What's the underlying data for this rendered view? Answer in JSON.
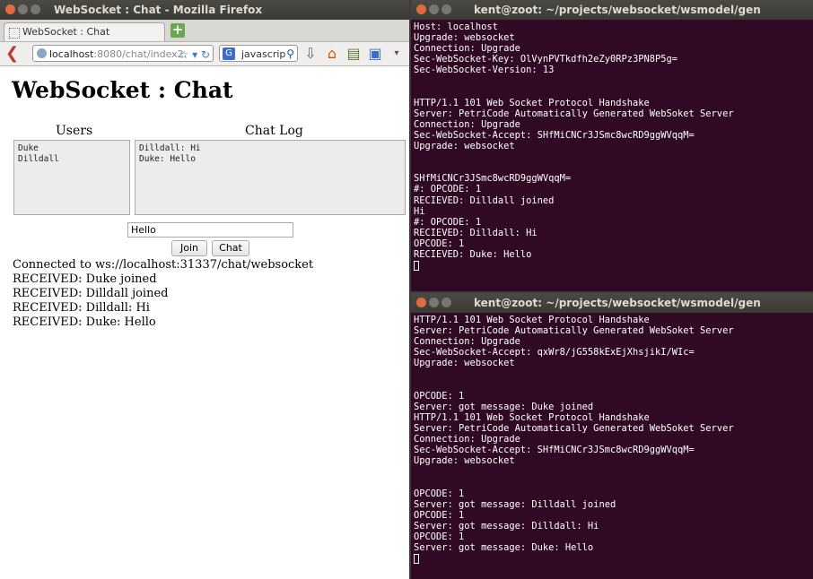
{
  "firefox": {
    "window_title": "WebSocket : Chat - Mozilla Firefox",
    "tab_title": "WebSocket : Chat",
    "url_host": "localhost",
    "url_rest": ":8080/chat/index2.",
    "search_text": "javascrip",
    "search_engine": "G"
  },
  "page": {
    "heading": "WebSocket : Chat",
    "users_label": "Users",
    "chatlog_label": "Chat Log",
    "users": "Duke\nDilldall",
    "chatlog": "Dilldall: Hi\nDuke: Hello",
    "message_value": "Hello",
    "join_label": "Join",
    "chat_label": "Chat",
    "log": [
      "Connected to ws://localhost:31337/chat/websocket",
      "RECEIVED: Duke joined",
      "RECEIVED: Dilldall joined",
      "RECEIVED: Dilldall: Hi",
      "RECEIVED: Duke: Hello"
    ]
  },
  "terminal_top": {
    "title": "kent@zoot: ~/projects/websocket/wsmodel/gen",
    "text": "Host: localhost\nUpgrade: websocket\nConnection: Upgrade\nSec-WebSocket-Key: OlVynPVTkdfh2eZy0RPz3PN8P5g=\nSec-WebSocket-Version: 13\n\n\nHTTP/1.1 101 Web Socket Protocol Handshake\nServer: PetriCode Automatically Generated WebSoket Server\nConnection: Upgrade\nSec-WebSocket-Accept: SHfMiCNCr3JSmc8wcRD9ggWVqqM=\nUpgrade: websocket\n\n\nSHfMiCNCr3JSmc8wcRD9ggWVqqM=\n#: OPCODE: 1\nRECIEVED: Dilldall joined\nHi\n#: OPCODE: 1\nRECIEVED: Dilldall: Hi\nOPCODE: 1\nRECIEVED: Duke: Hello"
  },
  "terminal_bottom": {
    "title": "kent@zoot: ~/projects/websocket/wsmodel/gen",
    "text": "HTTP/1.1 101 Web Socket Protocol Handshake\nServer: PetriCode Automatically Generated WebSoket Server\nConnection: Upgrade\nSec-WebSocket-Accept: qxWr8/jG558kExEjXhsjikI/WIc=\nUpgrade: websocket\n\n\nOPCODE: 1\nServer: got message: Duke joined\nHTTP/1.1 101 Web Socket Protocol Handshake\nServer: PetriCode Automatically Generated WebSoket Server\nConnection: Upgrade\nSec-WebSocket-Accept: SHfMiCNCr3JSmc8wcRD9ggWVqqM=\nUpgrade: websocket\n\n\nOPCODE: 1\nServer: got message: Dilldall joined\nOPCODE: 1\nServer: got message: Dilldall: Hi\nOPCODE: 1\nServer: got message: Duke: Hello"
  }
}
